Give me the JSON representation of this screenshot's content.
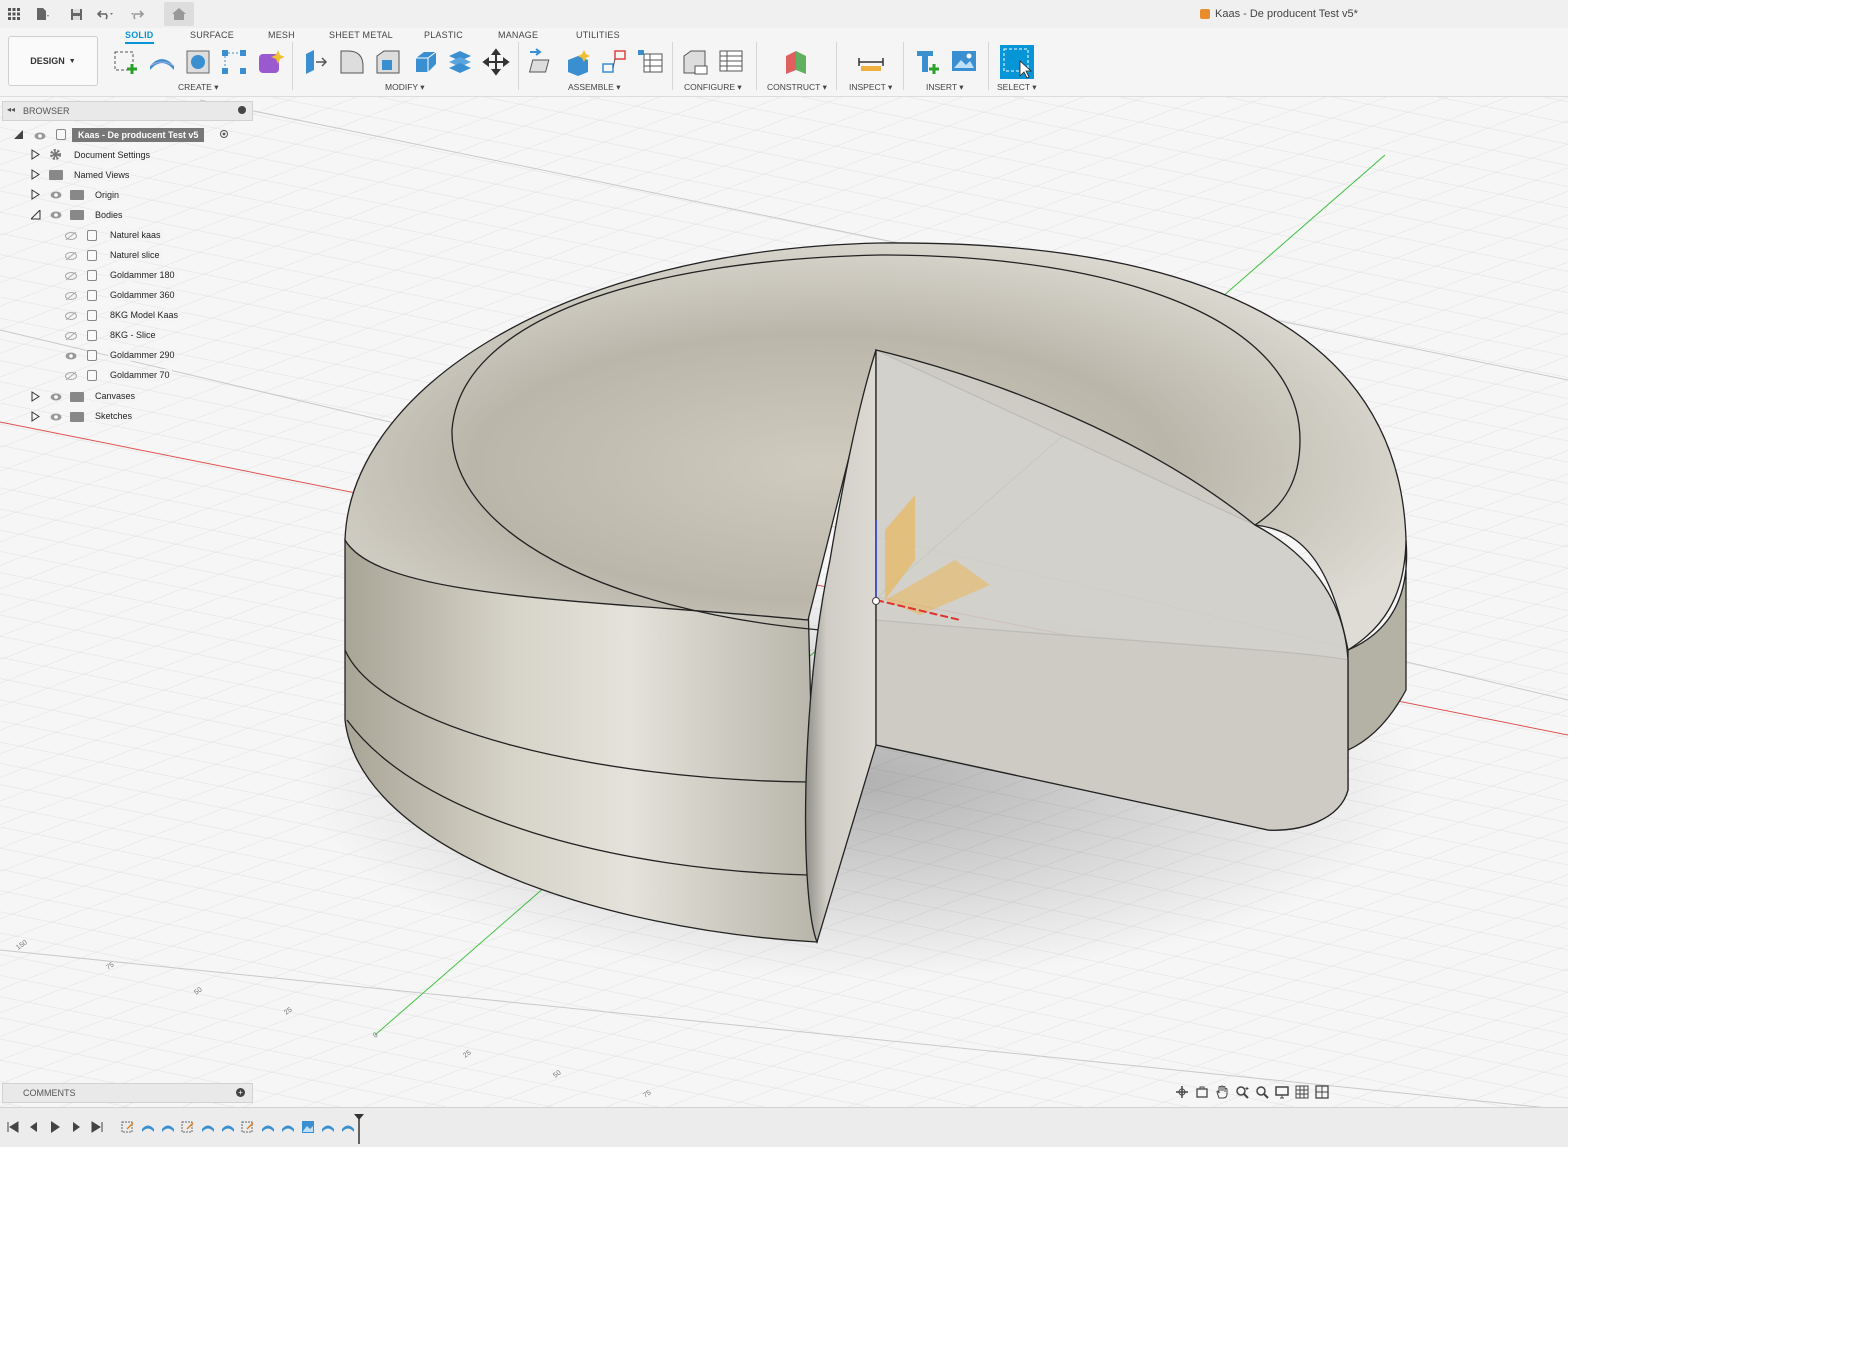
{
  "window": {
    "title": "Kaas - De producent Test v5*"
  },
  "workspace": {
    "label": "DESIGN"
  },
  "tabs": [
    {
      "label": "SOLID",
      "active": true
    },
    {
      "label": "SURFACE"
    },
    {
      "label": "MESH"
    },
    {
      "label": "SHEET METAL"
    },
    {
      "label": "PLASTIC"
    },
    {
      "label": "MANAGE"
    },
    {
      "label": "UTILITIES"
    }
  ],
  "groups": {
    "create": "CREATE",
    "modify": "MODIFY",
    "assemble": "ASSEMBLE",
    "configure": "CONFIGURE",
    "construct": "CONSTRUCT",
    "inspect": "INSPECT",
    "insert": "INSERT",
    "select": "SELECT"
  },
  "browser": {
    "title": "BROWSER",
    "root": "Kaas - De producent Test v5",
    "items": {
      "doc_settings": "Document Settings",
      "named_views": "Named Views",
      "origin": "Origin",
      "bodies": "Bodies",
      "canvases": "Canvases",
      "sketches": "Sketches"
    },
    "bodies": [
      "Naturel kaas",
      "Naturel slice",
      "Goldammer 180",
      "Goldammer 360",
      "8KG Model Kaas",
      "8KG - Slice",
      "Goldammer 290",
      "Goldammer 70"
    ]
  },
  "comments": {
    "title": "COMMENTS"
  },
  "grid_labels": [
    "150",
    "75",
    "50",
    "25",
    "0",
    "25",
    "50",
    "75"
  ],
  "colors": {
    "accent": "#0696d7",
    "body": "#c9c6bb",
    "x_axis": "#e05050",
    "y_axis": "#40c040",
    "origin_plane": "#f0b040"
  }
}
